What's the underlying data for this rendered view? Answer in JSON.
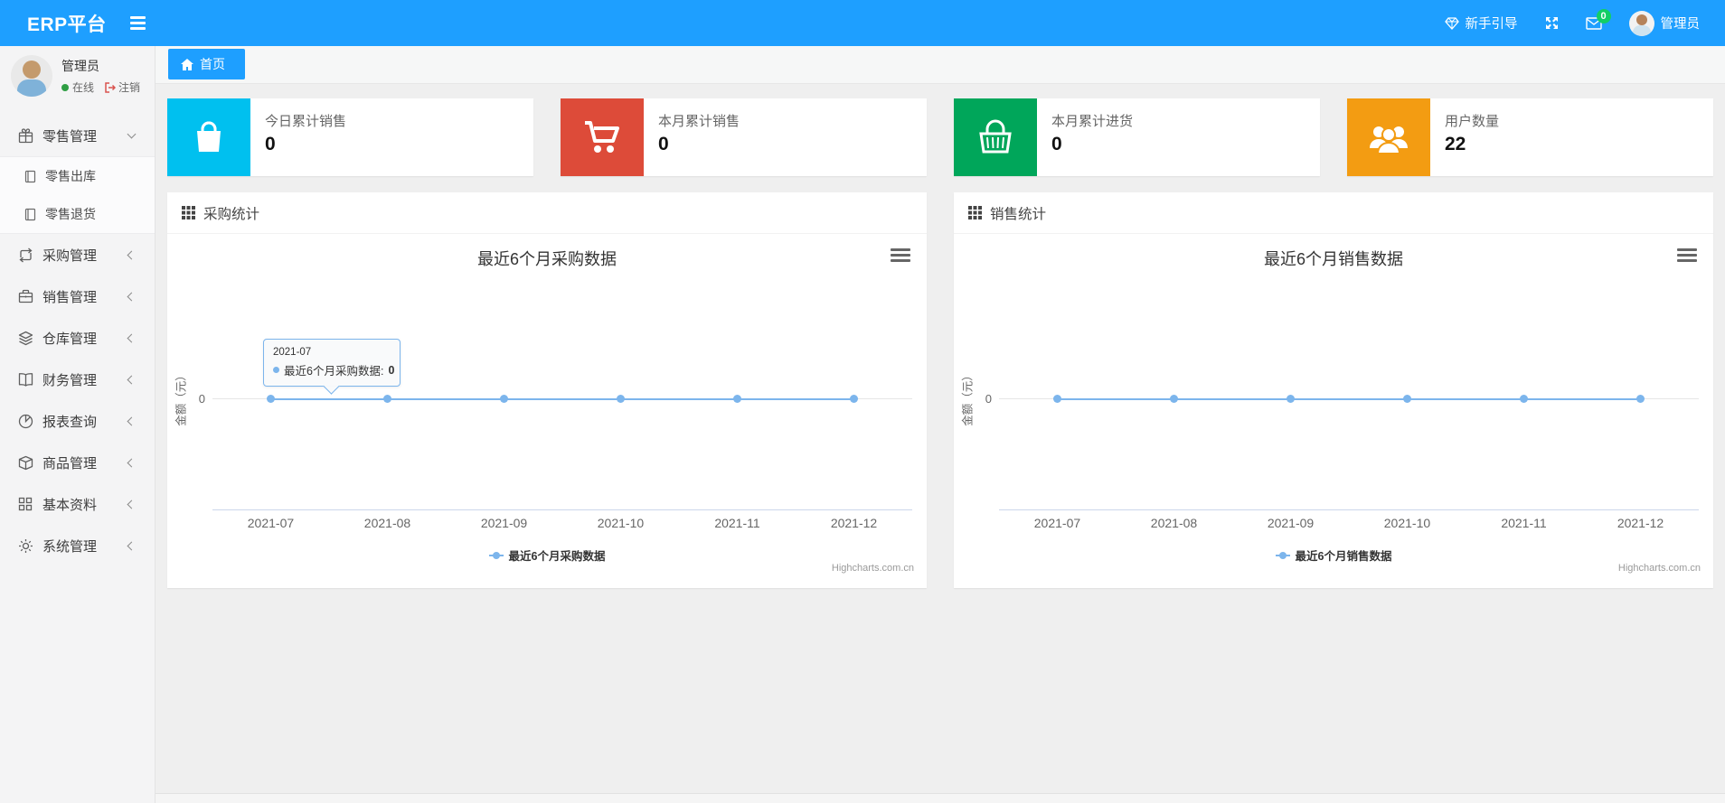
{
  "navbar": {
    "brand": "ERP平台",
    "guide_label": "新手引导",
    "badge_count": "0",
    "username": "管理员",
    "accent_color": "#1E9FFF",
    "badge_color": "#13ce66"
  },
  "sidebar": {
    "user": {
      "name": "管理员",
      "status": "在线",
      "logout": "注销"
    },
    "menu": [
      {
        "label": "零售管理",
        "icon": "gift-icon",
        "state": "expanded",
        "children": [
          {
            "label": "零售出库",
            "icon": "journal-icon"
          },
          {
            "label": "零售退货",
            "icon": "journal-icon"
          }
        ]
      },
      {
        "label": "采购管理",
        "icon": "exchange-icon",
        "state": "collapsed"
      },
      {
        "label": "销售管理",
        "icon": "briefcase-icon",
        "state": "collapsed"
      },
      {
        "label": "仓库管理",
        "icon": "layers-icon",
        "state": "collapsed"
      },
      {
        "label": "财务管理",
        "icon": "book-icon",
        "state": "collapsed"
      },
      {
        "label": "报表查询",
        "icon": "pie-chart-icon",
        "state": "collapsed"
      },
      {
        "label": "商品管理",
        "icon": "box-icon",
        "state": "collapsed"
      },
      {
        "label": "基本资料",
        "icon": "grid-icon",
        "state": "collapsed"
      },
      {
        "label": "系统管理",
        "icon": "gear-icon",
        "state": "collapsed"
      }
    ]
  },
  "tabs": [
    {
      "label": "首页",
      "icon": "home-icon",
      "active": true
    }
  ],
  "cards": [
    {
      "label": "今日累计销售",
      "value": "0",
      "color": "#00c0ef",
      "icon": "shopping-bag-icon"
    },
    {
      "label": "本月累计销售",
      "value": "0",
      "color": "#dd4b39",
      "icon": "shopping-cart-icon"
    },
    {
      "label": "本月累计进货",
      "value": "0",
      "color": "#00a65a",
      "icon": "basket-icon"
    },
    {
      "label": "用户数量",
      "value": "22",
      "color": "#f39c12",
      "icon": "users-icon"
    }
  ],
  "panels": [
    {
      "title": "采购统计"
    },
    {
      "title": "销售统计"
    }
  ],
  "chart_data": [
    {
      "type": "line",
      "title": "最近6个月采购数据",
      "categories": [
        "2021-07",
        "2021-08",
        "2021-09",
        "2021-10",
        "2021-11",
        "2021-12"
      ],
      "series": [
        {
          "name": "最近6个月采购数据",
          "values": [
            0,
            0,
            0,
            0,
            0,
            0
          ],
          "color": "#7cb5ec"
        }
      ],
      "xlabel": "",
      "ylabel": "金额（元）",
      "ytick_label": "0",
      "ylim": [
        0,
        0
      ],
      "grid": true,
      "legend_position": "bottom",
      "credit": "Highcharts.com.cn",
      "tooltip": {
        "header": "2021-07",
        "label": "最近6个月采购数据:",
        "value": "0"
      }
    },
    {
      "type": "line",
      "title": "最近6个月销售数据",
      "categories": [
        "2021-07",
        "2021-08",
        "2021-09",
        "2021-10",
        "2021-11",
        "2021-12"
      ],
      "series": [
        {
          "name": "最近6个月销售数据",
          "values": [
            0,
            0,
            0,
            0,
            0,
            0
          ],
          "color": "#7cb5ec"
        }
      ],
      "xlabel": "",
      "ylabel": "金额（元）",
      "ytick_label": "0",
      "ylim": [
        0,
        0
      ],
      "grid": true,
      "legend_position": "bottom",
      "credit": "Highcharts.com.cn"
    }
  ]
}
